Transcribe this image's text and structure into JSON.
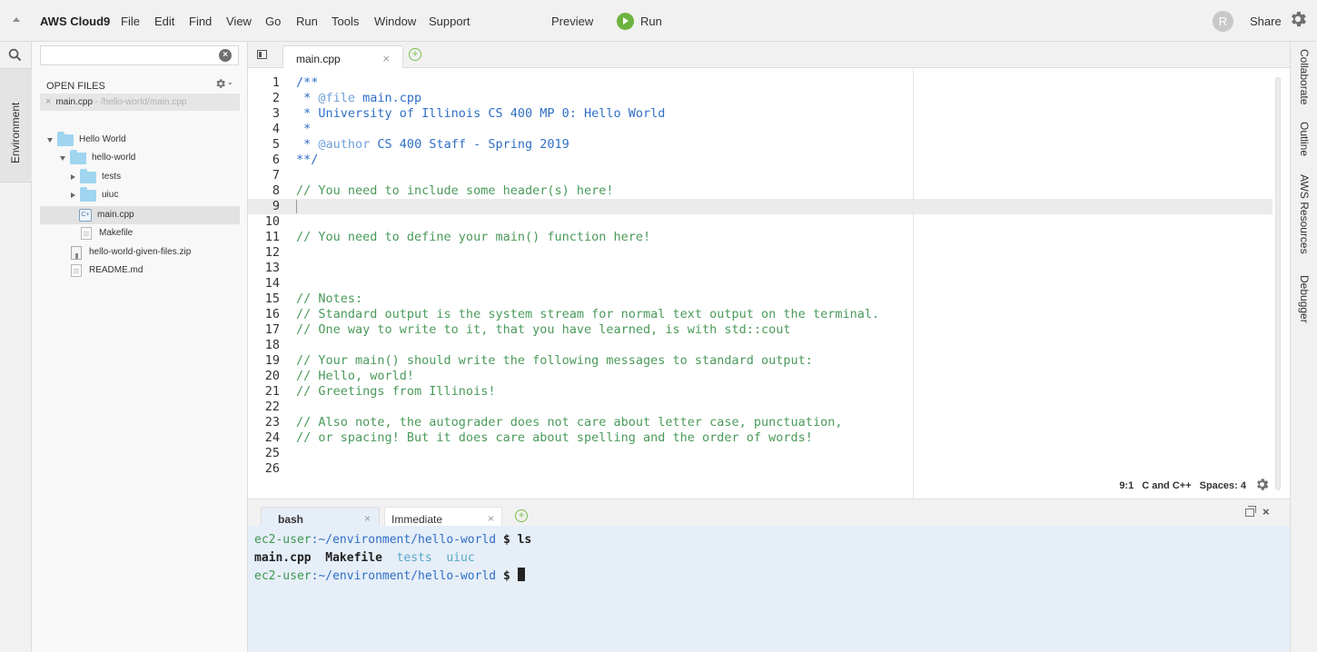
{
  "menubar": {
    "brand": "AWS Cloud9",
    "items": [
      "File",
      "Edit",
      "Find",
      "View",
      "Go",
      "Run",
      "Tools",
      "Window",
      "Support"
    ],
    "preview": "Preview",
    "run": "Run",
    "avatar_initial": "R",
    "share": "Share"
  },
  "left_strip": {
    "environment_tab": "Environment"
  },
  "sidebar": {
    "search": {
      "value": "",
      "placeholder": ""
    },
    "open_files_title": "OPEN FILES",
    "open_file": {
      "name": "main.cpp",
      "path": " - /hello-world/main.cpp"
    },
    "tree": [
      {
        "label": "Hello World",
        "type": "folder",
        "expanded": true
      },
      {
        "label": "hello-world",
        "type": "folder",
        "expanded": true
      },
      {
        "label": "tests",
        "type": "folder",
        "expanded": false
      },
      {
        "label": "uiuc",
        "type": "folder",
        "expanded": false
      },
      {
        "label": "main.cpp",
        "type": "cpp",
        "selected": true
      },
      {
        "label": "Makefile",
        "type": "file"
      },
      {
        "label": "hello-world-given-files.zip",
        "type": "zip"
      },
      {
        "label": "README.md",
        "type": "file"
      }
    ]
  },
  "editor": {
    "tab": "main.cpp",
    "lines": [
      "/**",
      " * @file main.cpp",
      " * University of Illinois CS 400 MP 0: Hello World",
      " *",
      " * @author CS 400 Staff - Spring 2019",
      "**/",
      "",
      "// You need to include some header(s) here!",
      "",
      "",
      "// You need to define your main() function here!",
      "",
      "",
      "",
      "// Notes:",
      "// Standard output is the system stream for normal text output on the terminal.",
      "// One way to write to it, that you have learned, is with std::cout",
      "",
      "// Your main() should write the following messages to standard output:",
      "// Hello, world!",
      "// Greetings from Illinois!",
      "",
      "// Also note, the autograder does not care about letter case, punctuation,",
      "// or spacing! But it does care about spelling and the order of words!",
      "",
      ""
    ],
    "status": {
      "position": "9:1",
      "language": "C and C++",
      "spaces": "Spaces: 4"
    }
  },
  "terminal": {
    "tabs": [
      "bash",
      "Immediate"
    ],
    "prompt_user": "ec2-user",
    "prompt_path": ":~/environment/hello-world",
    "prompt_symbol": " $ ",
    "command": "ls",
    "ls_output": {
      "files": [
        "main.cpp",
        "Makefile"
      ],
      "dirs": [
        "tests",
        "uiuc"
      ]
    }
  },
  "right_strip": [
    "Collaborate",
    "Outline",
    "AWS Resources",
    "Debugger"
  ],
  "colors": {
    "accent_green": "#6db33f",
    "folder_blue": "#9fd5ee",
    "comment_green": "#4a9a5a",
    "doc_blue": "#2f6fc6",
    "terminal_bg": "#e6eef8"
  }
}
